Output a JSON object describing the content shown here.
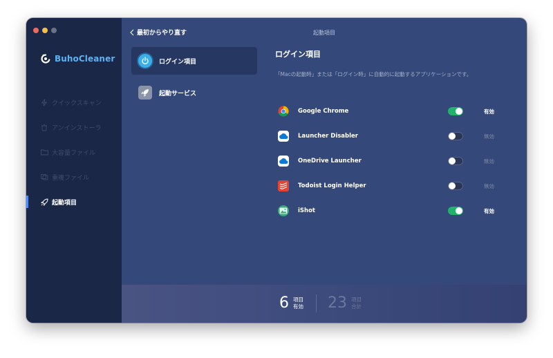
{
  "app": {
    "brand_name": "BuhoCleaner",
    "accent_color": "#5bb3f5"
  },
  "sidebar": {
    "items": [
      {
        "label": "クイックスキャン",
        "icon": "lightning-icon",
        "active": false
      },
      {
        "label": "アンインストーラ",
        "icon": "trash-icon",
        "active": false
      },
      {
        "label": "大容量ファイル",
        "icon": "folder-icon",
        "active": false
      },
      {
        "label": "重複ファイル",
        "icon": "duplicate-icon",
        "active": false
      },
      {
        "label": "起動項目",
        "icon": "rocket-icon",
        "active": true
      }
    ]
  },
  "topbar": {
    "back_label": "最初からやり直す",
    "title": "起動項目"
  },
  "categories": [
    {
      "label": "ログイン項目",
      "icon": "power-icon",
      "active": true
    },
    {
      "label": "起動サービス",
      "icon": "rocket-icon",
      "active": false
    }
  ],
  "detail": {
    "title": "ログイン項目",
    "description": "「Macの起動時」または「ログイン時」に自動的に起動するアプリケーションです。",
    "items": [
      {
        "name": "Google Chrome",
        "icon": "chrome-icon",
        "enabled": true,
        "status": "有効"
      },
      {
        "name": "Launcher Disabler",
        "icon": "cloud-icon",
        "enabled": false,
        "status": "無効"
      },
      {
        "name": "OneDrive Launcher",
        "icon": "onedrive-icon",
        "enabled": false,
        "status": "無効"
      },
      {
        "name": "Todoist Login Helper",
        "icon": "todoist-icon",
        "enabled": false,
        "status": "無効"
      },
      {
        "name": "iShot",
        "icon": "ishot-icon",
        "enabled": true,
        "status": "有効"
      }
    ]
  },
  "footer": {
    "enabled_count": "6",
    "enabled_label_1": "項目",
    "enabled_label_2": "有効",
    "total_count": "23",
    "total_label_1": "項目",
    "total_label_2": "合計"
  },
  "colors": {
    "toggle_on": "#22b26e",
    "active_indicator": "#4f8df5"
  }
}
